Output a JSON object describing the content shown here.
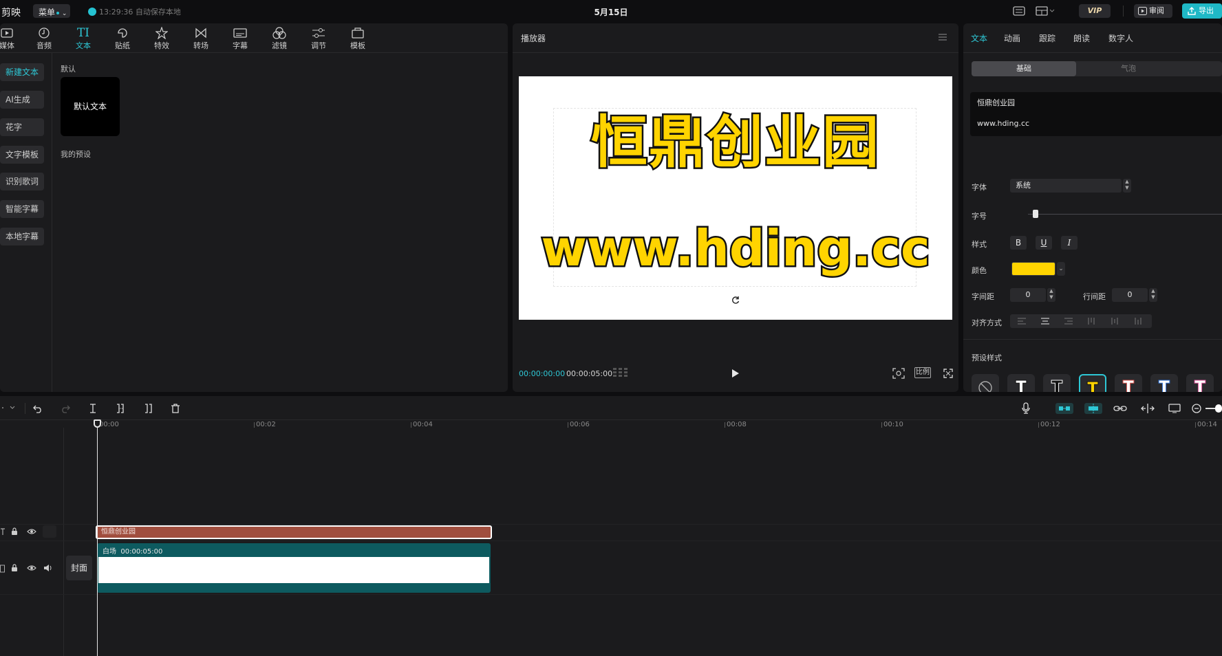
{
  "app": {
    "brand": "剪映",
    "menu_label": "菜单",
    "save_status": "13:29:36 自动保存本地",
    "date_title": "5月15日",
    "vip_label": "VIP",
    "review_label": "审阅",
    "export_label": "导出"
  },
  "media": {
    "tools": [
      {
        "label": "媒体",
        "icon": "media-icon"
      },
      {
        "label": "音频",
        "icon": "audio-icon"
      },
      {
        "label": "文本",
        "icon": "text-icon"
      },
      {
        "label": "贴纸",
        "icon": "sticker-icon"
      },
      {
        "label": "特效",
        "icon": "effects-icon"
      },
      {
        "label": "转场",
        "icon": "transition-icon"
      },
      {
        "label": "字幕",
        "icon": "subtitle-icon"
      },
      {
        "label": "滤镜",
        "icon": "filter-icon"
      },
      {
        "label": "调节",
        "icon": "adjust-icon"
      },
      {
        "label": "模板",
        "icon": "template-icon"
      }
    ],
    "sidebar": [
      "新建文本",
      "AI生成",
      "花字",
      "文字模板",
      "识别歌词",
      "智能字幕",
      "本地字幕"
    ],
    "section_default": "默认",
    "default_card": "默认文本",
    "section_presets": "我的预设"
  },
  "player": {
    "title": "播放器",
    "canvas_title": "恒鼎创业园",
    "canvas_url": "www.hding.cc",
    "time_current": "00:00:00:00",
    "time_total": "00:00:05:00",
    "ratio_label": "比例"
  },
  "inspector": {
    "tabs": [
      "文本",
      "动画",
      "跟踪",
      "朗读",
      "数字人"
    ],
    "seg_on": "基础",
    "seg_off": "气泡",
    "text_line1": "恒鼎创业园",
    "text_line2": "www.hding.cc",
    "font_label": "字体",
    "font_value": "系统",
    "size_label": "字号",
    "size_value": 0.04,
    "style_label": "样式",
    "bold": "B",
    "underline": "U",
    "italic": "I",
    "color_label": "颜色",
    "color_value": "#ffd400",
    "char_spacing_label": "字间距",
    "char_spacing_value": "0",
    "line_spacing_label": "行间距",
    "line_spacing_value": "0",
    "align_label": "对齐方式",
    "preset_label": "预设样式",
    "preset_glyph": "T"
  },
  "timeline": {
    "ruler": [
      "00:00",
      "00:02",
      "00:04",
      "00:06",
      "00:08",
      "00:10",
      "00:12",
      "00:14"
    ],
    "text_clip_label": "恒鼎创业园",
    "video_clip_name": "白场",
    "video_clip_duration": "00:00:05:00",
    "cover_label": "封面"
  }
}
